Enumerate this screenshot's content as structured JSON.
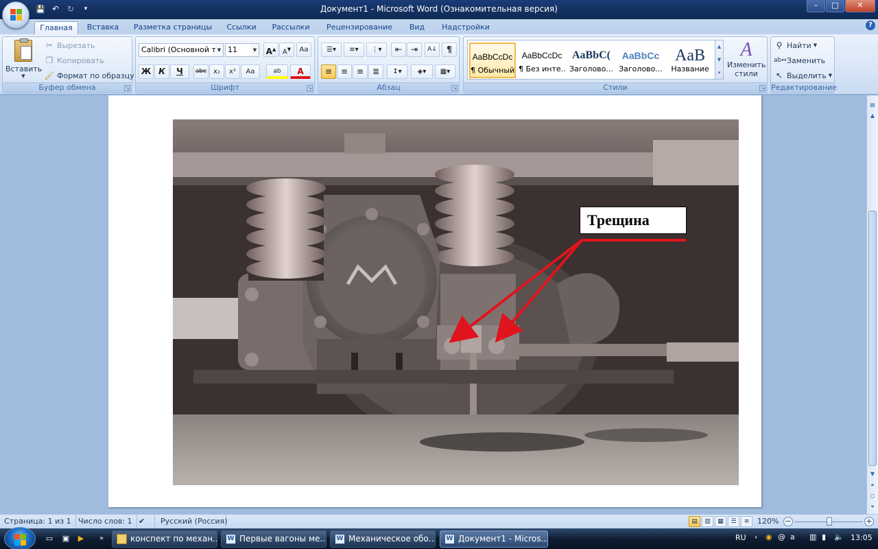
{
  "window": {
    "title": "Документ1 - Microsoft Word (Ознакомительная версия)",
    "controls": {
      "minimize": "–",
      "maximize": "□",
      "close": "✕"
    }
  },
  "qat": {
    "save": "💾",
    "undo": "↶",
    "redo": "↻",
    "customize": "▾"
  },
  "tabs": [
    "Главная",
    "Вставка",
    "Разметка страницы",
    "Ссылки",
    "Рассылки",
    "Рецензирование",
    "Вид",
    "Надстройки"
  ],
  "ribbon": {
    "clipboard": {
      "label": "Буфер обмена",
      "paste": "Вставить",
      "cut": "Вырезать",
      "copy": "Копировать",
      "format_painter": "Формат по образцу"
    },
    "font": {
      "label": "Шрифт",
      "font_name": "Calibri (Основной текст)",
      "font_size": "11",
      "grow": "A",
      "shrink": "A",
      "clear": "Aa",
      "bold": "Ж",
      "italic": "К",
      "underline": "Ч",
      "strike": "abc",
      "subscript": "x₂",
      "superscript": "x²",
      "case": "Aa",
      "highlight": "ab",
      "color": "A"
    },
    "paragraph": {
      "label": "Абзац",
      "show_marks": "¶",
      "sort": "А↓"
    },
    "styles": {
      "label": "Стили",
      "items": [
        {
          "sample": "AaBbCcDc",
          "name": "¶ Обычный"
        },
        {
          "sample": "AaBbCcDc",
          "name": "¶ Без инте..."
        },
        {
          "sample": "AaBbC(",
          "name": "Заголово..."
        },
        {
          "sample": "AaBbCc",
          "name": "Заголово..."
        },
        {
          "sample": "AaB",
          "name": "Название"
        }
      ],
      "change_styles": "Изменить стили"
    },
    "editing": {
      "label": "Редактирование",
      "find": "Найти",
      "replace": "Заменить",
      "select": "Выделить"
    }
  },
  "document": {
    "photo_label": "Трещина"
  },
  "statusbar": {
    "page": "Страница: 1 из 1",
    "words": "Число слов: 1",
    "language": "Русский (Россия)",
    "zoom": "120%"
  },
  "taskbar": {
    "tasks": [
      {
        "label": "конспект по механ...",
        "icon": "folder-icon"
      },
      {
        "label": "Первые вагоны ме...",
        "icon": "word-icon"
      },
      {
        "label": "Механическое обо...",
        "icon": "word-icon"
      },
      {
        "label": "Документ1 - Micros...",
        "icon": "word-icon"
      }
    ],
    "lang": "RU",
    "clock": "13:05"
  },
  "colors": {
    "accent": "#15428b",
    "arrow": "#e0141c"
  }
}
